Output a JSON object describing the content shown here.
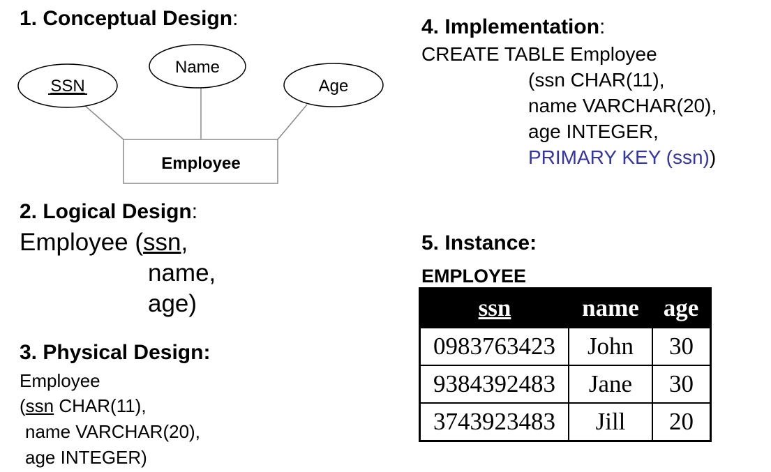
{
  "conceptual": {
    "heading": "1. Conceptual Design",
    "entity": "Employee",
    "attributes": [
      {
        "label": "SSN",
        "key": true
      },
      {
        "label": "Name",
        "key": false
      },
      {
        "label": "Age",
        "key": false
      }
    ]
  },
  "logical": {
    "heading": "2. Logical Design",
    "line1_prefix": "Employee (",
    "key": "ssn",
    "line1_suffix": ",",
    "line2": "name,",
    "line3": "age)"
  },
  "physical": {
    "heading": "3. Physical Design:",
    "line1": "Employee",
    "line2_prefix": "(",
    "key": "ssn",
    "line2_suffix": " CHAR(11),",
    "line3": "name VARCHAR(20),",
    "line4": "age INTEGER)"
  },
  "implementation": {
    "heading": "4. Implementation",
    "line1": "CREATE TABLE Employee",
    "line2": "(ssn CHAR(11),",
    "line3": "name VARCHAR(20),",
    "line4": "age INTEGER,",
    "line5_blue": "PRIMARY KEY (ssn)",
    "line5_end": ")",
    "accent_color": "#3535a8"
  },
  "instance": {
    "heading": "5. Instance:",
    "table_name": "EMPLOYEE",
    "columns": [
      "ssn",
      "name",
      "age"
    ],
    "rows": [
      [
        "0983763423",
        "John",
        "30"
      ],
      [
        "9384392483",
        "Jane",
        "30"
      ],
      [
        "3743923483",
        "Jill",
        "20"
      ]
    ]
  }
}
